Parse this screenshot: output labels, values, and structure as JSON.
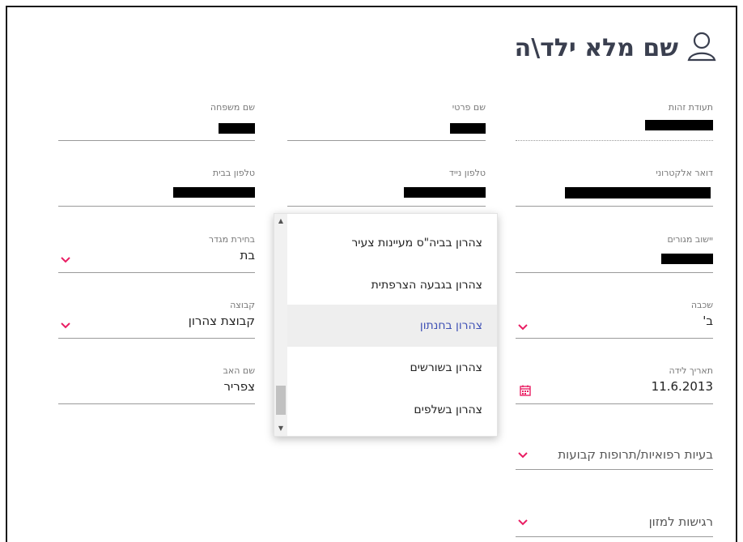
{
  "header": {
    "title": "שם מלא ילד\\ה"
  },
  "fields": {
    "id": {
      "label": "תעודת זהות",
      "value": ""
    },
    "first_name": {
      "label": "שם פרטי",
      "value": ""
    },
    "last_name": {
      "label": "שם משפחה",
      "value": ""
    },
    "email": {
      "label": "דואר אלקטרוני",
      "value": ""
    },
    "mobile": {
      "label": "טלפון נייד",
      "value": ""
    },
    "home_phone": {
      "label": "טלפון בבית",
      "value": ""
    },
    "city": {
      "label": "יישוב מגורים",
      "value": ""
    },
    "gender": {
      "label": "בחירת מגדר",
      "value": "בת"
    },
    "grade": {
      "label": "שכבה",
      "value": "ב'"
    },
    "group": {
      "label": "קבוצה",
      "value": "קבוצת צהרון"
    },
    "birth_date": {
      "label": "תאריך לידה",
      "value": "11.6.2013"
    },
    "father_name": {
      "label": "שם האב",
      "value": "צפריר"
    },
    "medical": {
      "label": "",
      "value": "בעיות רפואיות/תרופות קבועות"
    },
    "food": {
      "label": "",
      "value": "רגישות למזון"
    }
  },
  "dropdown": {
    "options": [
      {
        "label": "צהרון בביה\"ס מעיינות צעיר"
      },
      {
        "label": "צהרון בגבעה הצרפתית"
      },
      {
        "label": "צהרון בחנתון",
        "active": true
      },
      {
        "label": "צהרון בשורשים"
      },
      {
        "label": "צהרון בשלפים"
      }
    ]
  },
  "icons": {
    "title": "user-outline-icon",
    "calendar": "calendar-icon",
    "chevron": "chevron-down-icon"
  },
  "colors": {
    "accent": "#e91e63",
    "active": "#3f51b5",
    "title": "#3a3f4f"
  }
}
